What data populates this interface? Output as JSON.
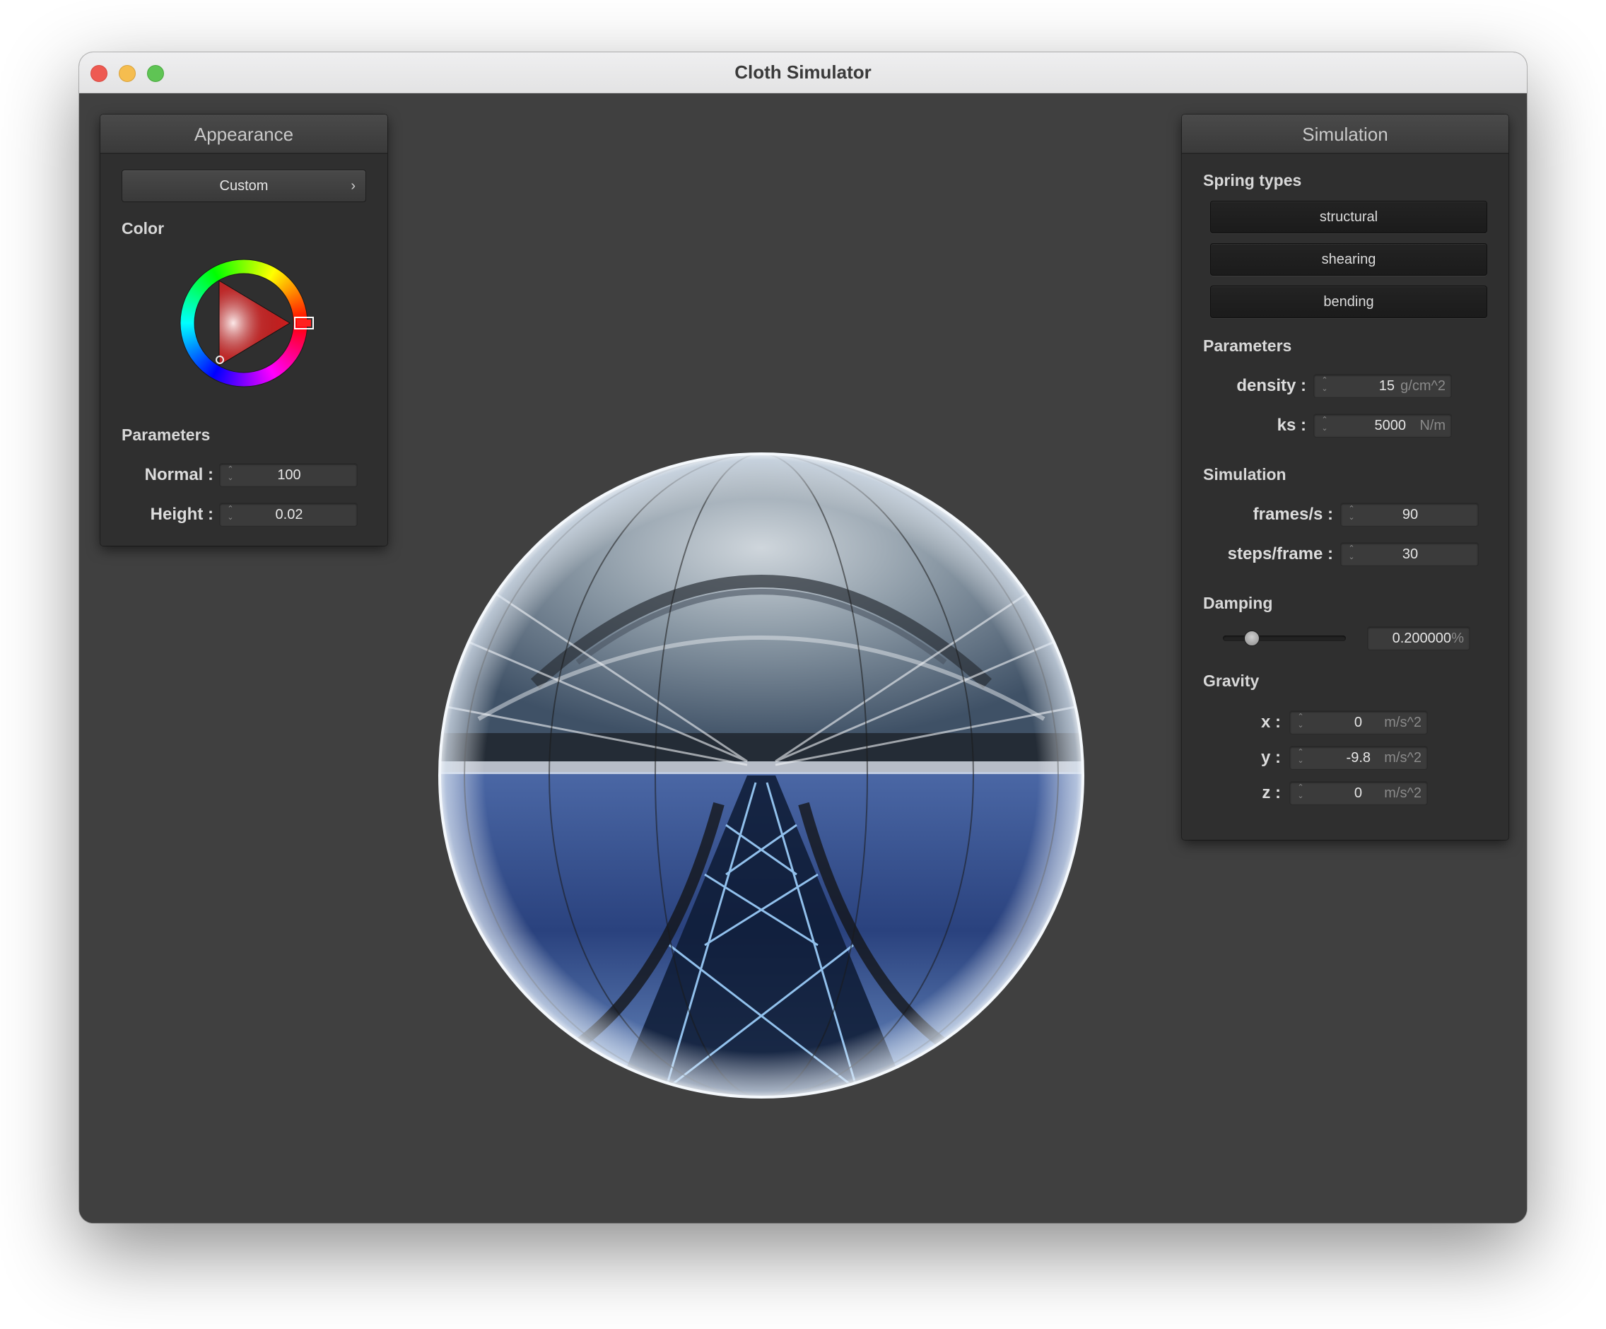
{
  "window": {
    "title": "Cloth Simulator"
  },
  "appearance": {
    "header": "Appearance",
    "preset": "Custom",
    "color_label": "Color",
    "params_label": "Parameters",
    "normal": {
      "label": "Normal :",
      "value": "100"
    },
    "height": {
      "label": "Height :",
      "value": "0.02"
    },
    "color_wheel": {
      "selected_hue": "#ff2020"
    }
  },
  "simulation_panel": {
    "header": "Simulation",
    "spring_types_label": "Spring types",
    "spring_types": [
      "structural",
      "shearing",
      "bending"
    ],
    "params_label": "Parameters",
    "density": {
      "label": "density :",
      "value": "15",
      "unit": "g/cm^2"
    },
    "ks": {
      "label": "ks :",
      "value": "5000",
      "unit": "N/m"
    },
    "simulation_label": "Simulation",
    "fps": {
      "label": "frames/s :",
      "value": "90"
    },
    "steps": {
      "label": "steps/frame :",
      "value": "30"
    },
    "damping_label": "Damping",
    "damping": {
      "value": "0.200000",
      "unit": "%",
      "slider_fraction": 0.2
    },
    "gravity_label": "Gravity",
    "gravity": [
      {
        "label": "x :",
        "value": "0",
        "unit": "m/s^2"
      },
      {
        "label": "y :",
        "value": "-9.8",
        "unit": "m/s^2"
      },
      {
        "label": "z :",
        "value": "0",
        "unit": "m/s^2"
      }
    ]
  },
  "colors": {
    "background": "#404040",
    "panel": "#2f2f2f",
    "accent_red": "#ff2020"
  }
}
